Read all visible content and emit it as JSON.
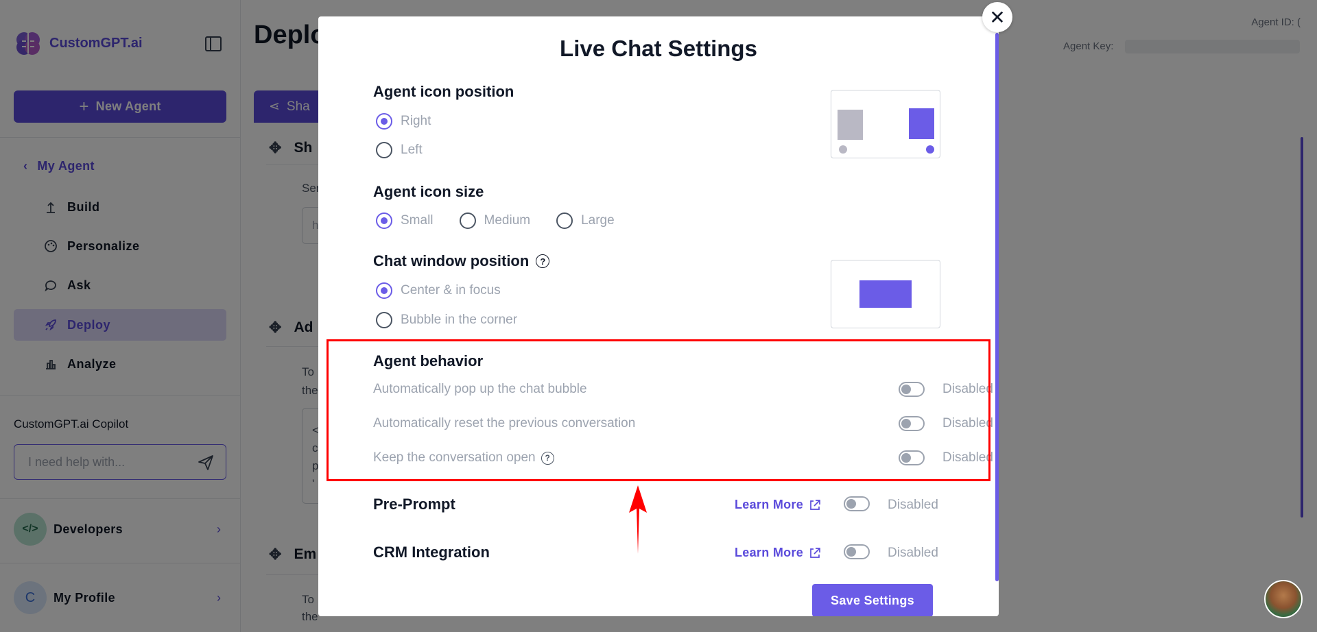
{
  "sidebar": {
    "brand": "CustomGPT.ai",
    "new_agent": "New Agent",
    "back_label": "My Agent",
    "nav": [
      {
        "label": "Build",
        "icon": "build-icon"
      },
      {
        "label": "Personalize",
        "icon": "palette-icon"
      },
      {
        "label": "Ask",
        "icon": "chat-icon"
      },
      {
        "label": "Deploy",
        "icon": "rocket-icon",
        "active": true
      },
      {
        "label": "Analyze",
        "icon": "chart-icon"
      }
    ],
    "copilot_title": "CustomGPT.ai Copilot",
    "copilot_placeholder": "I need help with...",
    "developers": "Developers",
    "developers_icon": "</>",
    "profile": "My Profile",
    "profile_initial": "C"
  },
  "main": {
    "title": "Deplo",
    "share_tab": "Sha",
    "sections": [
      "Sh",
      "Ad",
      "Em"
    ],
    "bg_texts": [
      "Ser",
      "h",
      "To",
      "the",
      "<",
      "c",
      "p",
      "'",
      "To",
      "the"
    ],
    "agent_id_label": "Agent ID: (",
    "agent_key_label": "Agent Key:"
  },
  "modal": {
    "title": "Live Chat Settings",
    "icon_position": {
      "heading": "Agent icon position",
      "options": [
        {
          "label": "Right",
          "selected": true
        },
        {
          "label": "Left",
          "selected": false
        }
      ]
    },
    "icon_size": {
      "heading": "Agent icon size",
      "options": [
        {
          "label": "Small",
          "selected": true
        },
        {
          "label": "Medium",
          "selected": false
        },
        {
          "label": "Large",
          "selected": false
        }
      ]
    },
    "window_position": {
      "heading": "Chat window position",
      "options": [
        {
          "label": "Center & in focus",
          "selected": true
        },
        {
          "label": "Bubble in the corner",
          "selected": false
        }
      ]
    },
    "behavior": {
      "heading": "Agent behavior",
      "rows": [
        {
          "label": "Automatically pop up the chat bubble",
          "status": "Disabled"
        },
        {
          "label": "Automatically reset the previous conversation",
          "status": "Disabled"
        },
        {
          "label": "Keep the conversation open",
          "status": "Disabled"
        }
      ]
    },
    "pre_prompt": {
      "heading": "Pre-Prompt",
      "link": "Learn More",
      "status": "Disabled"
    },
    "crm": {
      "heading": "CRM Integration",
      "link": "Learn More",
      "status": "Disabled"
    },
    "save": "Save Settings"
  },
  "colors": {
    "accent": "#5b4bdb",
    "accent_light": "#6b5ce7",
    "highlight": "#ff0000",
    "disabled_text": "#9ca3af"
  }
}
